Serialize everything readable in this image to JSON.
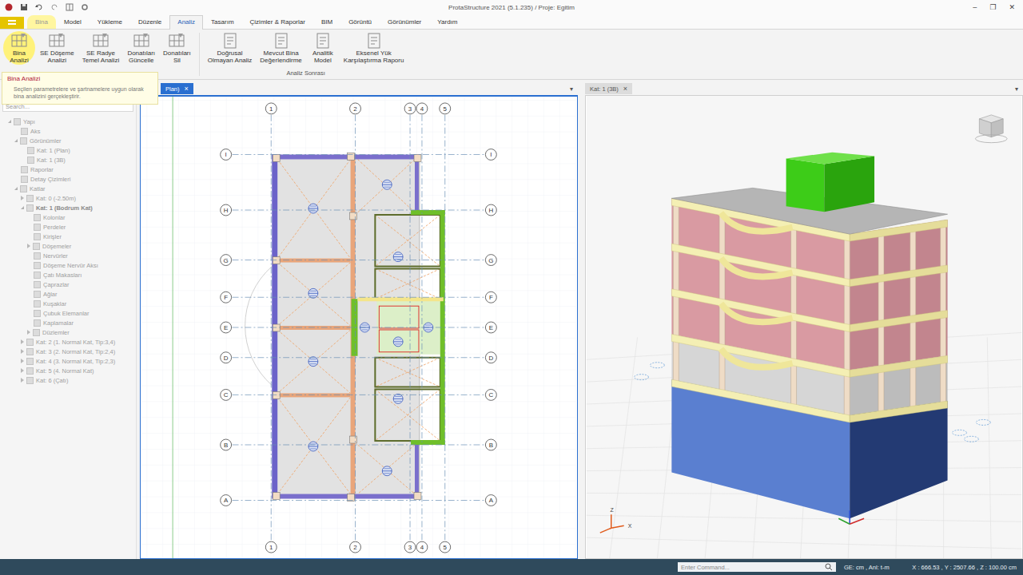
{
  "window": {
    "title": "ProtaStructure 2021 (5.1.235) / Proje: Egitim",
    "controls": [
      "–",
      "❐",
      "✕"
    ]
  },
  "ribbon_tabs": [
    {
      "label": "Bina",
      "selected": false,
      "hovered": true
    },
    {
      "label": "Model",
      "selected": false,
      "hovered": false
    },
    {
      "label": "Yükleme",
      "selected": false,
      "hovered": false
    },
    {
      "label": "Düzenle",
      "selected": false,
      "hovered": false
    },
    {
      "label": "Analiz",
      "selected": true,
      "hovered": false
    },
    {
      "label": "Tasarım",
      "selected": false,
      "hovered": false
    },
    {
      "label": "Çizimler & Raporlar",
      "selected": false,
      "hovered": false
    },
    {
      "label": "BIM",
      "selected": false,
      "hovered": false
    },
    {
      "label": "Görüntü",
      "selected": false,
      "hovered": false
    },
    {
      "label": "Görünümler",
      "selected": false,
      "hovered": false
    },
    {
      "label": "Yardım",
      "selected": false,
      "hovered": false
    }
  ],
  "analysis_buttons": [
    {
      "lines": [
        "Bina",
        "Analizi"
      ],
      "hovered": true
    },
    {
      "lines": [
        "SE Döşeme",
        "Analizi"
      ],
      "hovered": false
    },
    {
      "lines": [
        "SE Radye",
        "Temel Analizi"
      ],
      "hovered": false
    },
    {
      "lines": [
        "Donatıları",
        "Güncelle"
      ],
      "hovered": false
    },
    {
      "lines": [
        "Donatıları",
        "Sil"
      ],
      "hovered": false
    }
  ],
  "post_analysis": {
    "label": "Analiz Sonrası",
    "buttons": [
      {
        "lines": [
          "Doğrusal",
          "Olmayan Analiz"
        ],
        "hovered": false
      },
      {
        "lines": [
          "Mevcut Bina",
          "Değerlendirme"
        ],
        "hovered": false
      },
      {
        "lines": [
          "Analitik",
          "Model"
        ],
        "hovered": false
      },
      {
        "lines": [
          "Eksenel Yük",
          "Karşılaştırma Raporu"
        ],
        "hovered": false
      }
    ]
  },
  "tooltip": {
    "title": "Bina Analizi",
    "text": "Seçilen parametrelere ve şartnamelere uygun olarak bina analizini gerçekleştirir."
  },
  "tree": {
    "search_placeholder": "Search...",
    "items": [
      {
        "label": "Yapı",
        "depth": 0,
        "expandable": true,
        "expanded": true,
        "selected": false
      },
      {
        "label": "Aks",
        "depth": 1,
        "expandable": false,
        "expanded": false,
        "selected": false
      },
      {
        "label": "Görünümler",
        "depth": 1,
        "expandable": true,
        "expanded": true,
        "selected": false
      },
      {
        "label": "Kat: 1 (Plan)",
        "depth": 2,
        "expandable": false,
        "expanded": false,
        "selected": false
      },
      {
        "label": "Kat: 1 (3B)",
        "depth": 2,
        "expandable": false,
        "expanded": false,
        "selected": false
      },
      {
        "label": "Raporlar",
        "depth": 1,
        "expandable": false,
        "expanded": false,
        "selected": false
      },
      {
        "label": "Detay Çizimleri",
        "depth": 1,
        "expandable": false,
        "expanded": false,
        "selected": false
      },
      {
        "label": "Katlar",
        "depth": 1,
        "expandable": true,
        "expanded": true,
        "selected": false
      },
      {
        "label": "Kat: 0 (-2.50m)",
        "depth": 2,
        "expandable": true,
        "expanded": false,
        "selected": false
      },
      {
        "label": "Kat: 1 (Bodrum Kat)",
        "depth": 2,
        "expandable": true,
        "expanded": true,
        "selected": true
      },
      {
        "label": "Kolonlar",
        "depth": 3,
        "expandable": false,
        "expanded": false,
        "selected": false
      },
      {
        "label": "Perdeler",
        "depth": 3,
        "expandable": false,
        "expanded": false,
        "selected": false
      },
      {
        "label": "Kirişler",
        "depth": 3,
        "expandable": false,
        "expanded": false,
        "selected": false
      },
      {
        "label": "Döşemeler",
        "depth": 3,
        "expandable": true,
        "expanded": false,
        "selected": false
      },
      {
        "label": "Nervürler",
        "depth": 3,
        "expandable": false,
        "expanded": false,
        "selected": false
      },
      {
        "label": "Döşeme Nervür Aksı",
        "depth": 3,
        "expandable": false,
        "expanded": false,
        "selected": false
      },
      {
        "label": "Çatı Makasları",
        "depth": 3,
        "expandable": false,
        "expanded": false,
        "selected": false
      },
      {
        "label": "Çaprazlar",
        "depth": 3,
        "expandable": false,
        "expanded": false,
        "selected": false
      },
      {
        "label": "Ağlar",
        "depth": 3,
        "expandable": false,
        "expanded": false,
        "selected": false
      },
      {
        "label": "Kuşaklar",
        "depth": 3,
        "expandable": false,
        "expanded": false,
        "selected": false
      },
      {
        "label": "Çubuk Elemanlar",
        "depth": 3,
        "expandable": false,
        "expanded": false,
        "selected": false
      },
      {
        "label": "Kaplamalar",
        "depth": 3,
        "expandable": false,
        "expanded": false,
        "selected": false
      },
      {
        "label": "Düzlemler",
        "depth": 3,
        "expandable": true,
        "expanded": false,
        "selected": false
      },
      {
        "label": "Kat: 2 (1. Normal Kat, Tip:3,4)",
        "depth": 2,
        "expandable": true,
        "expanded": false,
        "selected": false
      },
      {
        "label": "Kat: 3 (2. Normal Kat, Tip:2,4)",
        "depth": 2,
        "expandable": true,
        "expanded": false,
        "selected": false
      },
      {
        "label": "Kat: 4 (3. Normal Kat, Tip:2,3)",
        "depth": 2,
        "expandable": true,
        "expanded": false,
        "selected": false
      },
      {
        "label": "Kat: 5 (4. Normal Kat)",
        "depth": 2,
        "expandable": true,
        "expanded": false,
        "selected": false
      },
      {
        "label": "Kat: 6 (Çatı)",
        "depth": 2,
        "expandable": true,
        "expanded": false,
        "selected": false
      }
    ]
  },
  "plan_view": {
    "tab": {
      "label": "Plan)",
      "close": "×",
      "selected": true
    },
    "menu": "▾",
    "columns": [
      "1",
      "2",
      "3",
      "4",
      "5"
    ],
    "rows": [
      "I",
      "H",
      "G",
      "F",
      "E",
      "D",
      "C",
      "B",
      "A"
    ]
  },
  "view_3d": {
    "tab": {
      "label": "Kat: 1 (3B)",
      "close": "×",
      "selected": false
    },
    "menu": "▾",
    "axes": [
      "Z",
      "X"
    ]
  },
  "status_bar": {
    "command_placeholder": "Enter Command...",
    "units": "GE: cm , Anl: t-m",
    "coords": "X : 666.53 , Y : 2507.66 , Z : 100.00 cm"
  }
}
